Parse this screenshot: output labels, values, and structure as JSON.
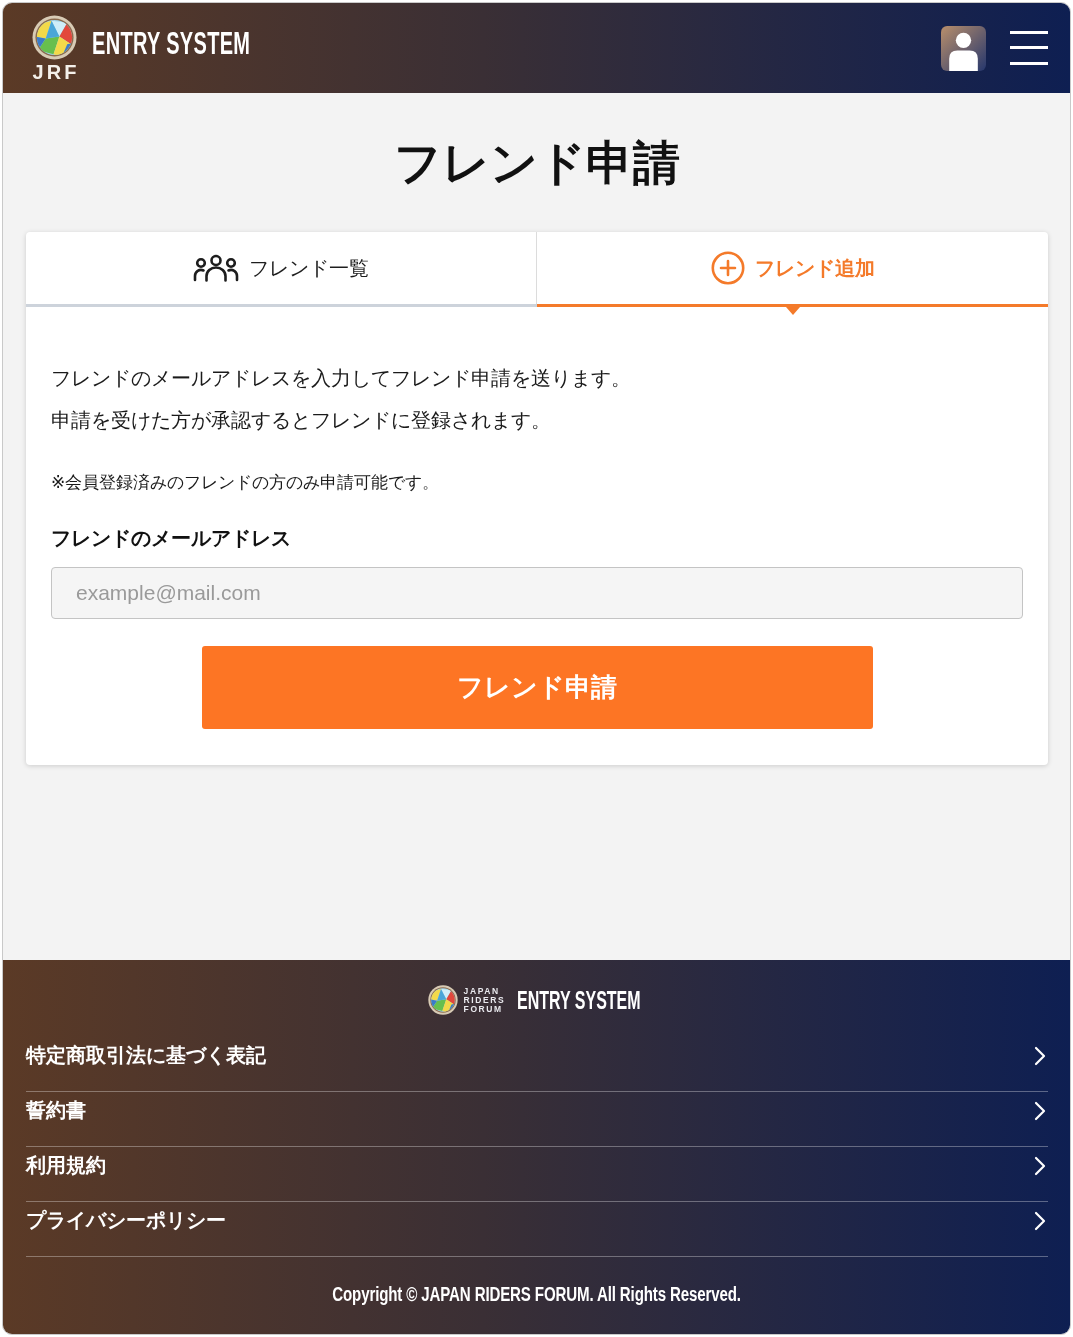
{
  "header": {
    "logo_text": "JRF",
    "title": "ENTRY SYSTEM"
  },
  "page_title": "フレンド申請",
  "tabs": [
    {
      "kind": "list",
      "label": "フレンド一覧",
      "selected": false
    },
    {
      "kind": "add",
      "label": "フレンド追加",
      "selected": true
    }
  ],
  "intro": [
    "フレンドのメールアドレスを入力してフレンド申請を送ります。",
    "申請を受けた方が承認するとフレンドに登録されます。"
  ],
  "note": "※会員登録済みのフレンドの方のみ申請可能です。",
  "email_field": {
    "label": "フレンドのメールアドレス",
    "placeholder": "example@mail.com"
  },
  "submit_button": "フレンド申請",
  "footer": {
    "logo_lines": [
      "JAPAN",
      "RIDERS",
      "FORUM"
    ],
    "title": "ENTRY SYSTEM",
    "links": [
      "特定商取引法に基づく表記",
      "誓約書",
      "利用規約",
      "プライバシーポリシー"
    ],
    "copyright": "Copyright © JAPAN RIDERS FORUM. All Rights Reserved."
  }
}
